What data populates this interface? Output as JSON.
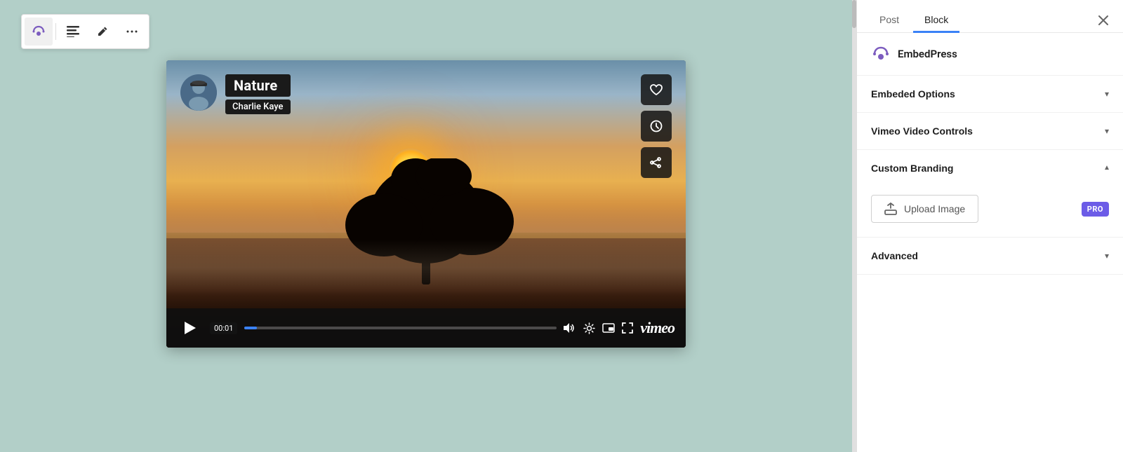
{
  "toolbar": {
    "embedpress_icon": "EP",
    "align_label": "Align",
    "edit_label": "Edit",
    "more_label": "More"
  },
  "video": {
    "title": "Nature",
    "author": "Charlie Kaye",
    "timestamp": "00:01",
    "progress_pct": 4
  },
  "sidebar": {
    "tab_post": "Post",
    "tab_block": "Block",
    "ep_brand": "EmbedPress",
    "section_embedded_options": "Embeded Options",
    "section_vimeo_controls": "Vimeo Video Controls",
    "section_custom_branding": "Custom Branding",
    "upload_image_label": "Upload Image",
    "pro_badge": "PRO",
    "section_advanced": "Advanced"
  },
  "colors": {
    "accent_blue": "#3b82f6",
    "pro_purple": "#6c5ce7",
    "active_tab_border": "#3b82f6"
  }
}
